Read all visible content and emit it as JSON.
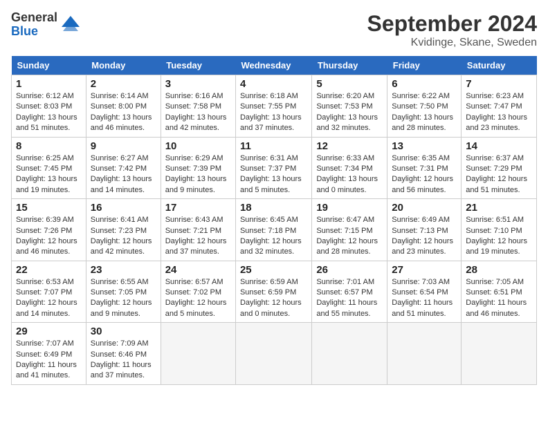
{
  "logo": {
    "general": "General",
    "blue": "Blue"
  },
  "title": "September 2024",
  "subtitle": "Kvidinge, Skane, Sweden",
  "days_of_week": [
    "Sunday",
    "Monday",
    "Tuesday",
    "Wednesday",
    "Thursday",
    "Friday",
    "Saturday"
  ],
  "weeks": [
    [
      {
        "day": "1",
        "sunrise": "6:12 AM",
        "sunset": "8:03 PM",
        "daylight": "13 hours and 51 minutes."
      },
      {
        "day": "2",
        "sunrise": "6:14 AM",
        "sunset": "8:00 PM",
        "daylight": "13 hours and 46 minutes."
      },
      {
        "day": "3",
        "sunrise": "6:16 AM",
        "sunset": "7:58 PM",
        "daylight": "13 hours and 42 minutes."
      },
      {
        "day": "4",
        "sunrise": "6:18 AM",
        "sunset": "7:55 PM",
        "daylight": "13 hours and 37 minutes."
      },
      {
        "day": "5",
        "sunrise": "6:20 AM",
        "sunset": "7:53 PM",
        "daylight": "13 hours and 32 minutes."
      },
      {
        "day": "6",
        "sunrise": "6:22 AM",
        "sunset": "7:50 PM",
        "daylight": "13 hours and 28 minutes."
      },
      {
        "day": "7",
        "sunrise": "6:23 AM",
        "sunset": "7:47 PM",
        "daylight": "13 hours and 23 minutes."
      }
    ],
    [
      {
        "day": "8",
        "sunrise": "6:25 AM",
        "sunset": "7:45 PM",
        "daylight": "13 hours and 19 minutes."
      },
      {
        "day": "9",
        "sunrise": "6:27 AM",
        "sunset": "7:42 PM",
        "daylight": "13 hours and 14 minutes."
      },
      {
        "day": "10",
        "sunrise": "6:29 AM",
        "sunset": "7:39 PM",
        "daylight": "13 hours and 9 minutes."
      },
      {
        "day": "11",
        "sunrise": "6:31 AM",
        "sunset": "7:37 PM",
        "daylight": "13 hours and 5 minutes."
      },
      {
        "day": "12",
        "sunrise": "6:33 AM",
        "sunset": "7:34 PM",
        "daylight": "13 hours and 0 minutes."
      },
      {
        "day": "13",
        "sunrise": "6:35 AM",
        "sunset": "7:31 PM",
        "daylight": "12 hours and 56 minutes."
      },
      {
        "day": "14",
        "sunrise": "6:37 AM",
        "sunset": "7:29 PM",
        "daylight": "12 hours and 51 minutes."
      }
    ],
    [
      {
        "day": "15",
        "sunrise": "6:39 AM",
        "sunset": "7:26 PM",
        "daylight": "12 hours and 46 minutes."
      },
      {
        "day": "16",
        "sunrise": "6:41 AM",
        "sunset": "7:23 PM",
        "daylight": "12 hours and 42 minutes."
      },
      {
        "day": "17",
        "sunrise": "6:43 AM",
        "sunset": "7:21 PM",
        "daylight": "12 hours and 37 minutes."
      },
      {
        "day": "18",
        "sunrise": "6:45 AM",
        "sunset": "7:18 PM",
        "daylight": "12 hours and 32 minutes."
      },
      {
        "day": "19",
        "sunrise": "6:47 AM",
        "sunset": "7:15 PM",
        "daylight": "12 hours and 28 minutes."
      },
      {
        "day": "20",
        "sunrise": "6:49 AM",
        "sunset": "7:13 PM",
        "daylight": "12 hours and 23 minutes."
      },
      {
        "day": "21",
        "sunrise": "6:51 AM",
        "sunset": "7:10 PM",
        "daylight": "12 hours and 19 minutes."
      }
    ],
    [
      {
        "day": "22",
        "sunrise": "6:53 AM",
        "sunset": "7:07 PM",
        "daylight": "12 hours and 14 minutes."
      },
      {
        "day": "23",
        "sunrise": "6:55 AM",
        "sunset": "7:05 PM",
        "daylight": "12 hours and 9 minutes."
      },
      {
        "day": "24",
        "sunrise": "6:57 AM",
        "sunset": "7:02 PM",
        "daylight": "12 hours and 5 minutes."
      },
      {
        "day": "25",
        "sunrise": "6:59 AM",
        "sunset": "6:59 PM",
        "daylight": "12 hours and 0 minutes."
      },
      {
        "day": "26",
        "sunrise": "7:01 AM",
        "sunset": "6:57 PM",
        "daylight": "11 hours and 55 minutes."
      },
      {
        "day": "27",
        "sunrise": "7:03 AM",
        "sunset": "6:54 PM",
        "daylight": "11 hours and 51 minutes."
      },
      {
        "day": "28",
        "sunrise": "7:05 AM",
        "sunset": "6:51 PM",
        "daylight": "11 hours and 46 minutes."
      }
    ],
    [
      {
        "day": "29",
        "sunrise": "7:07 AM",
        "sunset": "6:49 PM",
        "daylight": "11 hours and 41 minutes."
      },
      {
        "day": "30",
        "sunrise": "7:09 AM",
        "sunset": "6:46 PM",
        "daylight": "11 hours and 37 minutes."
      },
      null,
      null,
      null,
      null,
      null
    ]
  ],
  "labels": {
    "sunrise": "Sunrise:",
    "sunset": "Sunset:",
    "daylight": "Daylight:"
  }
}
